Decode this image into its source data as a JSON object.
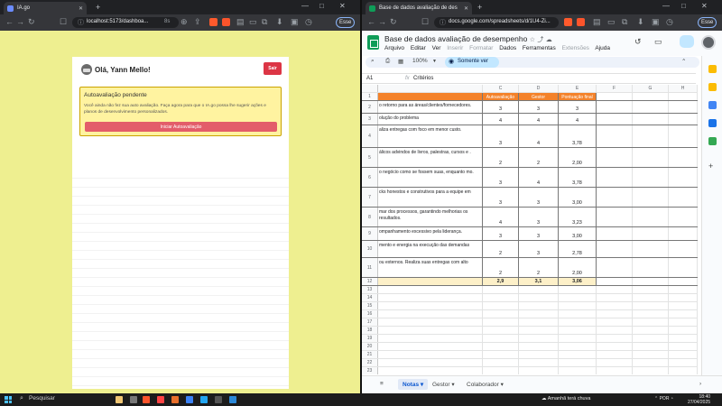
{
  "left_window": {
    "tab_title": "IA.go",
    "address": "localhost:5173/dashboa...",
    "extension_badge": "8s",
    "account_pill": "Esse",
    "app": {
      "greeting": "Olá, Yann Mello!",
      "logout_label": "Sair",
      "alert_title": "Autoavaliação pendente",
      "alert_text": "Você ainda não fez sua auto avaliação. Faça agora para que o IA.go possa lhe sugerir ações e planos de desenvolvimento personalizados.",
      "start_button": "Iniciar Autoavaliação"
    }
  },
  "right_window": {
    "tab_title": "Base de dados avaliação de des",
    "address": "docs.google.com/spreadsheets/d/1U4-Zi...",
    "account_pill": "Esse",
    "sheets": {
      "doc_title": "Base de dados avaliação de desempenho",
      "menu": [
        "Arquivo",
        "Editar",
        "Ver",
        "Inserir",
        "Formatar",
        "Dados",
        "Ferramentas",
        "Extensões",
        "Ajuda"
      ],
      "menu_dim": [
        "Inserir",
        "Formatar",
        "Extensões"
      ],
      "zoom": "100%",
      "view_only": "Somente ver",
      "cell_ref": "A1",
      "formula_value": "Critérios",
      "column_headers": [
        "",
        "C",
        "D",
        "E",
        "F",
        "G",
        "H"
      ],
      "header_row": {
        "b": "",
        "c": "Autoavaliação",
        "d": "Gestor",
        "e": "Pontuação final"
      },
      "rows": [
        {
          "n": "2",
          "b": "o retorno para as áreas/clientes/fornecedores.",
          "c": "3",
          "d": "3",
          "e": "3"
        },
        {
          "n": "3",
          "b": "olução do problema",
          "c": "4",
          "d": "4",
          "e": "4"
        },
        {
          "n": "4",
          "b": "aliza entregas com foco em menor custo.",
          "c": "3",
          "d": "4",
          "e": "3,78"
        },
        {
          "n": "5",
          "b": "álicos advindos de livros, palestras, cursos e .",
          "c": "2",
          "d": "2",
          "e": "2,00"
        },
        {
          "n": "6",
          "b": "o negócio como se fossem suas, enquanto mo.",
          "c": "3",
          "d": "4",
          "e": "3,78"
        },
        {
          "n": "7",
          "b": "cks honestos e construtivos para a equipe em",
          "c": "3",
          "d": "3",
          "e": "3,00"
        },
        {
          "n": "8",
          "b": "mar dos processos, garantindo melhorias os resultados.",
          "c": "4",
          "d": "3",
          "e": "3,23"
        },
        {
          "n": "9",
          "b": "ompanhamento excessivo pela liderança.",
          "c": "3",
          "d": "3",
          "e": "3,00"
        },
        {
          "n": "10",
          "b": "mento e energia na execução das demandas",
          "c": "2",
          "d": "3",
          "e": "2,78"
        },
        {
          "n": "11",
          "b": "ou externos. Realiza suas entregas com alto",
          "c": "2",
          "d": "2",
          "e": "2,00"
        }
      ],
      "totals": {
        "n": "12",
        "c": "2,9",
        "d": "3,1",
        "e": "3,06"
      },
      "empty_rows": [
        "13",
        "14",
        "15",
        "16",
        "17",
        "18",
        "19",
        "20",
        "21",
        "22",
        "23"
      ],
      "sheet_tabs": [
        "Notas",
        "Gestor",
        "Colaborador"
      ],
      "active_tab": "Notas"
    }
  },
  "taskbar": {
    "search_placeholder": "Pesquisar",
    "weather": "Amanhã terá chuva",
    "language": "POR",
    "time": "18:40",
    "date": "27/04/2025"
  },
  "colors": {
    "app_bg": "#eeef90",
    "alert_bg": "#fff3a0",
    "danger": "#dc3545",
    "header_orange": "#f4822a",
    "sheets_green": "#0f9d58"
  }
}
